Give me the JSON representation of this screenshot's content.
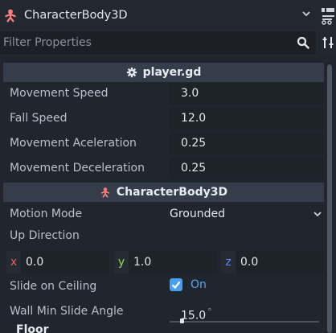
{
  "header": {
    "node_name": "CharacterBody3D",
    "node_icon": "character-body-icon",
    "filter_placeholder": "Filter Properties"
  },
  "script_section": {
    "title": "player.gd",
    "icon": "gear-icon",
    "rows": [
      {
        "label": "Movement Speed",
        "value": "3.0"
      },
      {
        "label": "Fall Speed",
        "value": "12.0"
      },
      {
        "label": "Movement Aceleration",
        "value": "0.25"
      },
      {
        "label": "Movement Deceleration",
        "value": "0.25"
      }
    ]
  },
  "body_section": {
    "title": "CharacterBody3D",
    "icon": "character-body-icon",
    "motion_mode": {
      "label": "Motion Mode",
      "value": "Grounded"
    },
    "up_direction": {
      "label": "Up Direction",
      "x_label": "x",
      "x": "0.0",
      "y_label": "y",
      "y": "1.0",
      "z_label": "z",
      "z": "0.0"
    },
    "slide_on_ceiling": {
      "label": "Slide on Ceiling",
      "checkbox_label": "On",
      "checked": true
    },
    "wall_min_slide_angle": {
      "label": "Wall Min Slide Angle",
      "value": "15.0",
      "unit": "°",
      "slider_fraction": 0.083
    }
  },
  "next_section_clipped": "Floor",
  "colors": {
    "accent": "#4a9eeb",
    "node_red": "#fc7f7f",
    "axis_x": "#e5635f",
    "axis_y": "#8ad95e",
    "axis_z": "#5d87f5"
  }
}
